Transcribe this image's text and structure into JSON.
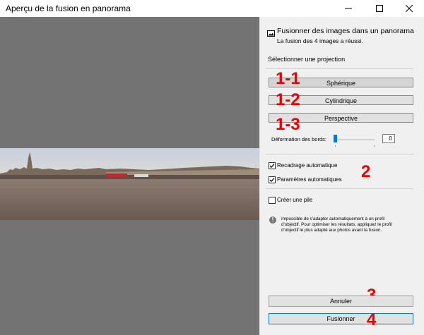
{
  "window": {
    "title": "Aperçu de la fusion en panorama",
    "controls": {
      "minimize": "—",
      "maximize": "☐",
      "close": "✕"
    }
  },
  "header": {
    "icon": "panorama-icon",
    "title": "Fusionner des images dans un panorama",
    "subtitle": "La fusion des 4 images a réussi."
  },
  "projection": {
    "label": "Sélectionner une projection",
    "buttons": [
      "Sphérique",
      "Cylindrique",
      "Perspective"
    ],
    "selected": "Sphérique"
  },
  "boundary": {
    "label": "Déformation des bords:",
    "value": "0"
  },
  "options": {
    "auto_crop": {
      "label": "Recadrage automatique",
      "checked": true
    },
    "auto_settings": {
      "label": "Paramètres automatiques",
      "checked": true
    },
    "create_stack": {
      "label": "Créer une pile",
      "checked": false
    }
  },
  "info": {
    "icon": "info-icon",
    "text": "Impossible de s'adapter automatiquement à un profil d'objectif. Pour optimiser les résultats, appliquez le profil d'objectif le plus adapté aux photos avant la fusion."
  },
  "actions": {
    "cancel": "Annuler",
    "merge": "Fusionner"
  },
  "callouts": [
    "1-1",
    "1-2",
    "1-3",
    "2",
    "3",
    "4"
  ],
  "colors": {
    "preview_bg": "#737373",
    "callout": "#e60000",
    "accent": "#0078d7"
  }
}
